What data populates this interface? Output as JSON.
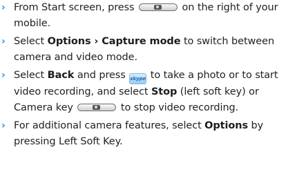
{
  "instructions": [
    {
      "before": "From Start screen, press ",
      "key": "camera-key",
      "after": " on the right of your mobile."
    },
    {
      "select": "Select ",
      "options": "Options",
      "arrow": " › ",
      "capture": "Capture mode",
      "rest": " to switch between camera and video mode."
    },
    {
      "select": "Select ",
      "back": "Back",
      "press": " and press ",
      "skype_glyph": "skype",
      "mid": " to take a photo or to start video recording, and select ",
      "stop": "Stop",
      "paren": " (left soft key) or Camera key ",
      "end": " to stop video recording."
    },
    {
      "before": "For additional camera features, select ",
      "options": "Options",
      "after": " by pressing Left Soft Key."
    }
  ],
  "bullet_char": "›",
  "colors": {
    "bullet": "#2a8fd6",
    "text": "#222222"
  }
}
